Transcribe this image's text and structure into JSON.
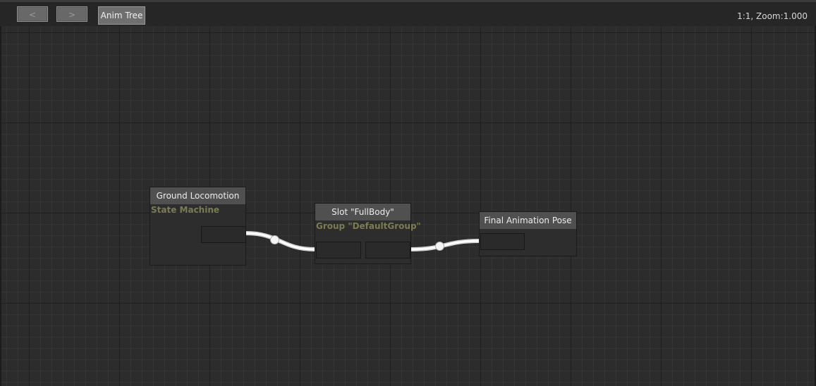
{
  "toolbar": {
    "back_label": "<",
    "forward_label": ">",
    "breadcrumb": "Anim Tree",
    "zoom_readout": "1:1, Zoom:1.000"
  },
  "nodes": {
    "ground_locomotion": {
      "title": "Ground Locomotion",
      "subtitle": "State Machine"
    },
    "slot": {
      "title": "Slot \"FullBody\"",
      "subtitle": "Group \"DefaultGroup\""
    },
    "final_pose": {
      "title": "Final Animation Pose"
    }
  },
  "colors": {
    "background": "#2a2a2a",
    "node_header": "#505050",
    "subtitle_text": "#7c7c54",
    "wire": "#f2f2f2"
  }
}
